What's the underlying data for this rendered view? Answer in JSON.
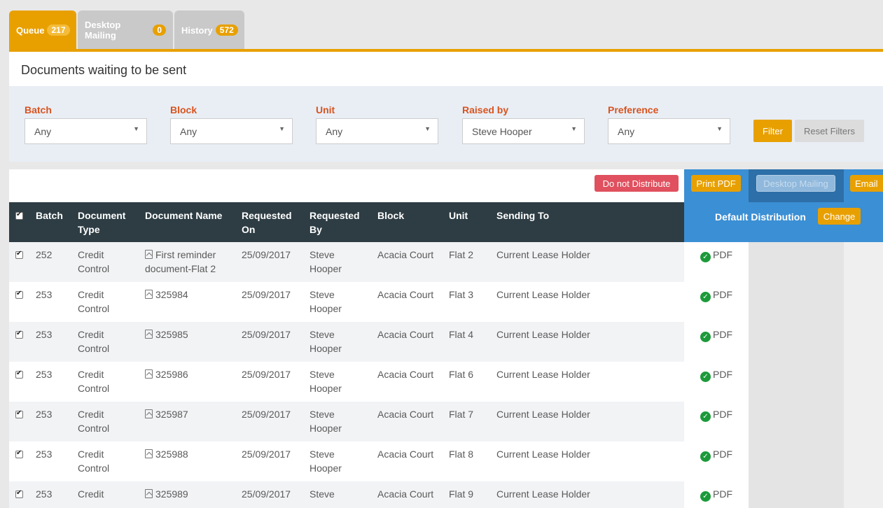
{
  "tabs": [
    {
      "label": "Queue",
      "count": "217"
    },
    {
      "label": "Desktop Mailing",
      "count": "0"
    },
    {
      "label": "History",
      "count": "572"
    }
  ],
  "page_title": "Documents waiting to be sent",
  "filters": {
    "batch": {
      "label": "Batch",
      "value": "Any"
    },
    "block": {
      "label": "Block",
      "value": "Any"
    },
    "unit": {
      "label": "Unit",
      "value": "Any"
    },
    "raised_by": {
      "label": "Raised by",
      "value": "Steve Hooper"
    },
    "preference": {
      "label": "Preference",
      "value": "Any"
    },
    "filter_button": "Filter",
    "reset_button": "Reset Filters"
  },
  "actions": {
    "do_not_distribute": "Do not Distribute",
    "print_pdf": "Print PDF",
    "desktop_mailing": "Desktop Mailing",
    "email": "Email"
  },
  "columns": {
    "batch": "Batch",
    "document_type": "Document Type",
    "document_name": "Document Name",
    "requested_on": "Requested On",
    "requested_by": "Requested By",
    "block": "Block",
    "unit": "Unit",
    "sending_to": "Sending To",
    "default_distribution": "Default Distribution",
    "change_button": "Change"
  },
  "rows": [
    {
      "batch": "252",
      "type": "Credit Control",
      "name": "First reminder document-Flat 2",
      "requested_on": "25/09/2017",
      "requested_by": "Steve Hooper",
      "block": "Acacia Court",
      "unit": "Flat 2",
      "sending_to": "Current Lease Holder",
      "distribution": "PDF"
    },
    {
      "batch": "253",
      "type": "Credit Control",
      "name": "325984",
      "requested_on": "25/09/2017",
      "requested_by": "Steve Hooper",
      "block": "Acacia Court",
      "unit": "Flat 3",
      "sending_to": "Current Lease Holder",
      "distribution": "PDF"
    },
    {
      "batch": "253",
      "type": "Credit Control",
      "name": "325985",
      "requested_on": "25/09/2017",
      "requested_by": "Steve Hooper",
      "block": "Acacia Court",
      "unit": "Flat 4",
      "sending_to": "Current Lease Holder",
      "distribution": "PDF"
    },
    {
      "batch": "253",
      "type": "Credit Control",
      "name": "325986",
      "requested_on": "25/09/2017",
      "requested_by": "Steve Hooper",
      "block": "Acacia Court",
      "unit": "Flat 6",
      "sending_to": "Current Lease Holder",
      "distribution": "PDF"
    },
    {
      "batch": "253",
      "type": "Credit Control",
      "name": "325987",
      "requested_on": "25/09/2017",
      "requested_by": "Steve Hooper",
      "block": "Acacia Court",
      "unit": "Flat 7",
      "sending_to": "Current Lease Holder",
      "distribution": "PDF"
    },
    {
      "batch": "253",
      "type": "Credit Control",
      "name": "325988",
      "requested_on": "25/09/2017",
      "requested_by": "Steve Hooper",
      "block": "Acacia Court",
      "unit": "Flat 8",
      "sending_to": "Current Lease Holder",
      "distribution": "PDF"
    },
    {
      "batch": "253",
      "type": "Credit",
      "name": "325989",
      "requested_on": "25/09/2017",
      "requested_by": "Steve",
      "block": "Acacia Court",
      "unit": "Flat 9",
      "sending_to": "Current Lease Holder",
      "distribution": "PDF"
    }
  ]
}
